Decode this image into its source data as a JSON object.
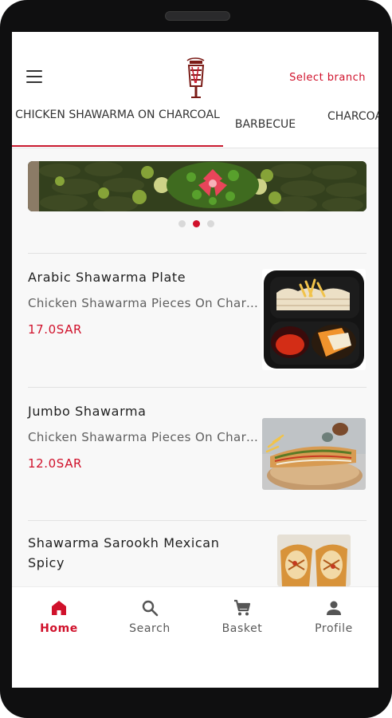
{
  "header": {
    "branch_label": "Select branch",
    "logo_icon": "shawarma-logo"
  },
  "tabs": [
    {
      "label": "CHICKEN SHAWARMA ON CHARCOAL",
      "active": true
    },
    {
      "label": "BARBECUE",
      "active": false
    },
    {
      "label": "CHARCOAL",
      "active": false
    }
  ],
  "carousel": {
    "page_count": 3,
    "active_index": 1
  },
  "items": [
    {
      "title": "Arabic Shawarma Plate",
      "desc": "Chicken Shawarma Pieces On Charcoal",
      "price": "17.0SAR"
    },
    {
      "title": "Jumbo Shawarma",
      "desc": "Chicken Shawarma Pieces On Charcoal",
      "price": "12.0SAR"
    },
    {
      "title_line1": "Shawarma Sarookh Mexican",
      "title_line2": "Spicy"
    }
  ],
  "nav": {
    "home": "Home",
    "search": "Search",
    "basket": "Basket",
    "profile": "Profile"
  },
  "colors": {
    "accent": "#d0112b",
    "text": "#1f1f1f"
  }
}
